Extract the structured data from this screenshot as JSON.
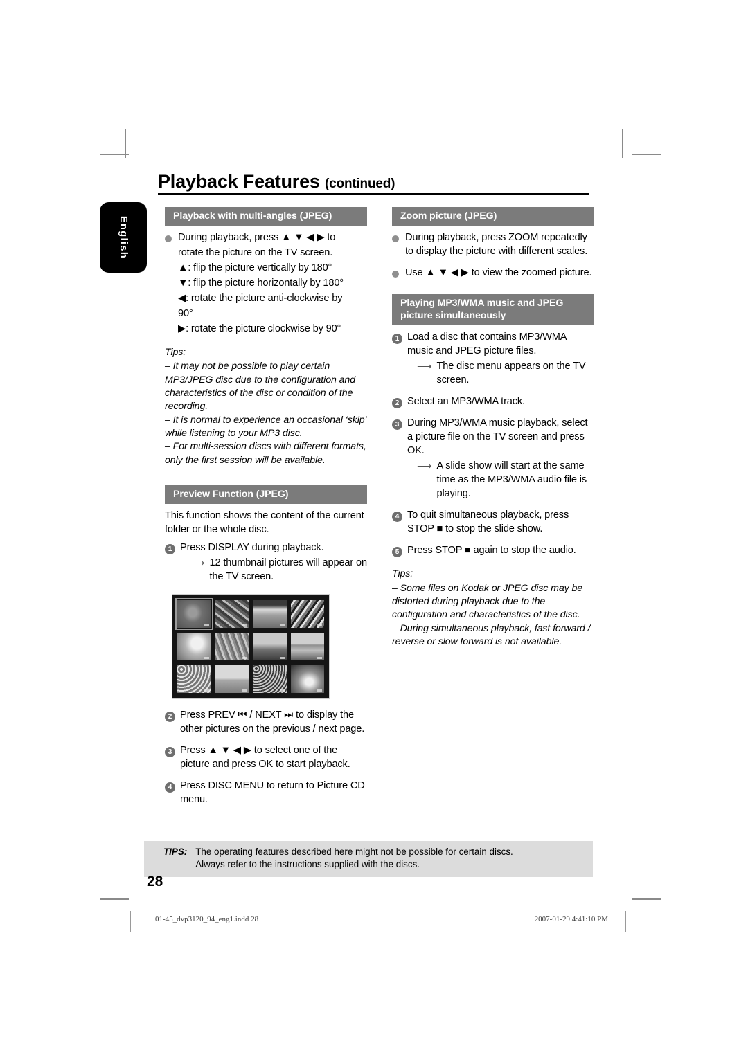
{
  "header": {
    "title": "Playback Features",
    "continued": "(continued)"
  },
  "language_tab": {
    "label": "English"
  },
  "left_column": {
    "section_multiangle": {
      "heading": "Playback with multi-angles (JPEG)",
      "bullets": [
        {
          "lines": [
            "During playback, press ▲ ▼ ◀ ▶ to",
            "rotate the picture on the TV screen.",
            "▲: flip the picture vertically by 180°",
            "▼: flip the picture horizontally by 180°",
            "◀: rotate the picture anti-clockwise by",
            "90°",
            "▶: rotate the picture clockwise by 90°"
          ]
        }
      ],
      "tips": {
        "head": "Tips:",
        "items": [
          "– It may not be possible to play certain MP3/JPEG disc due to the configuration and characteristics of the disc or condition of the recording.",
          "– It is normal to experience an occasional ‘skip’ while listening to your MP3 disc.",
          "– For multi-session discs with different formats, only the first session will be available."
        ]
      }
    },
    "section_preview": {
      "heading": "Preview Function (JPEG)",
      "intro": "This function shows the content of the current folder or the whole disc.",
      "steps": [
        {
          "number": "1",
          "text": "Press DISPLAY during playback.",
          "bold": "DISPLAY",
          "arrows": [
            "12 thumbnail pictures will appear on the TV screen."
          ]
        },
        {
          "number": "2",
          "text": "Press PREV ⏮ / NEXT ⏭ to display the other pictures on the previous / next page.",
          "arrows": []
        },
        {
          "number": "3",
          "text": "Press ▲ ▼ ◀ ▶ to select one of the picture and press OK to start playback.",
          "arrows": []
        },
        {
          "number": "4",
          "text": "Press DISC MENU to return to Picture CD menu.",
          "arrows": []
        }
      ],
      "thumbnail_screen": {
        "name": "tv-preview-screen",
        "columns": 4,
        "rows": 3,
        "count": 12,
        "selected_index": 1,
        "background_color": "#151515"
      }
    }
  },
  "right_column": {
    "section_zoom": {
      "heading": "Zoom picture (JPEG)",
      "bullets": [
        "During playback, press ZOOM repeatedly to display the picture with different scales.",
        "Use ▲ ▼ ◀ ▶ to view the zoomed picture."
      ]
    },
    "section_simultaneous": {
      "heading_line1": "Playing MP3/WMA music and JPEG",
      "heading_line2": "picture simultaneously",
      "steps": [
        {
          "number": "1",
          "text": "Load a disc that contains MP3/WMA music and JPEG picture files.",
          "arrows": [
            "The disc menu appears on the TV screen."
          ]
        },
        {
          "number": "2",
          "text": "Select an MP3/WMA track.",
          "arrows": []
        },
        {
          "number": "3",
          "text": "During MP3/WMA music playback, select a picture file on the TV screen and press OK.",
          "arrows": [
            "A slide show will start at the same time as the MP3/WMA audio file is playing."
          ]
        },
        {
          "number": "4",
          "text": "To quit simultaneous playback, press STOP ■ to stop the slide show.",
          "arrows": []
        },
        {
          "number": "5",
          "text": "Press STOP ■ again to stop the audio.",
          "arrows": []
        }
      ],
      "tips": {
        "head": "Tips:",
        "items": [
          "– Some files on Kodak or JPEG disc may be distorted during playback due to the configuration and characteristics of the disc.",
          "– During simultaneous playback, fast forward / reverse or slow forward is not available."
        ]
      }
    }
  },
  "tips_strip": {
    "label": "TIPS:",
    "line1": "The operating features described here might not be possible for certain discs.",
    "line2": "Always refer to the instructions supplied with the discs."
  },
  "page_number": "28",
  "print_footer": {
    "file": "01-45_dvp3120_94_eng1.indd   28",
    "timestamp": "2007-01-29   4:41:10 PM"
  },
  "colors": {
    "section_bar": "#7b7b7b",
    "bullet": "#8f8f8f",
    "number_badge": "#6e6e6e",
    "tips_strip_bg": "#dcdcdc",
    "tab_bg": "#000000"
  }
}
